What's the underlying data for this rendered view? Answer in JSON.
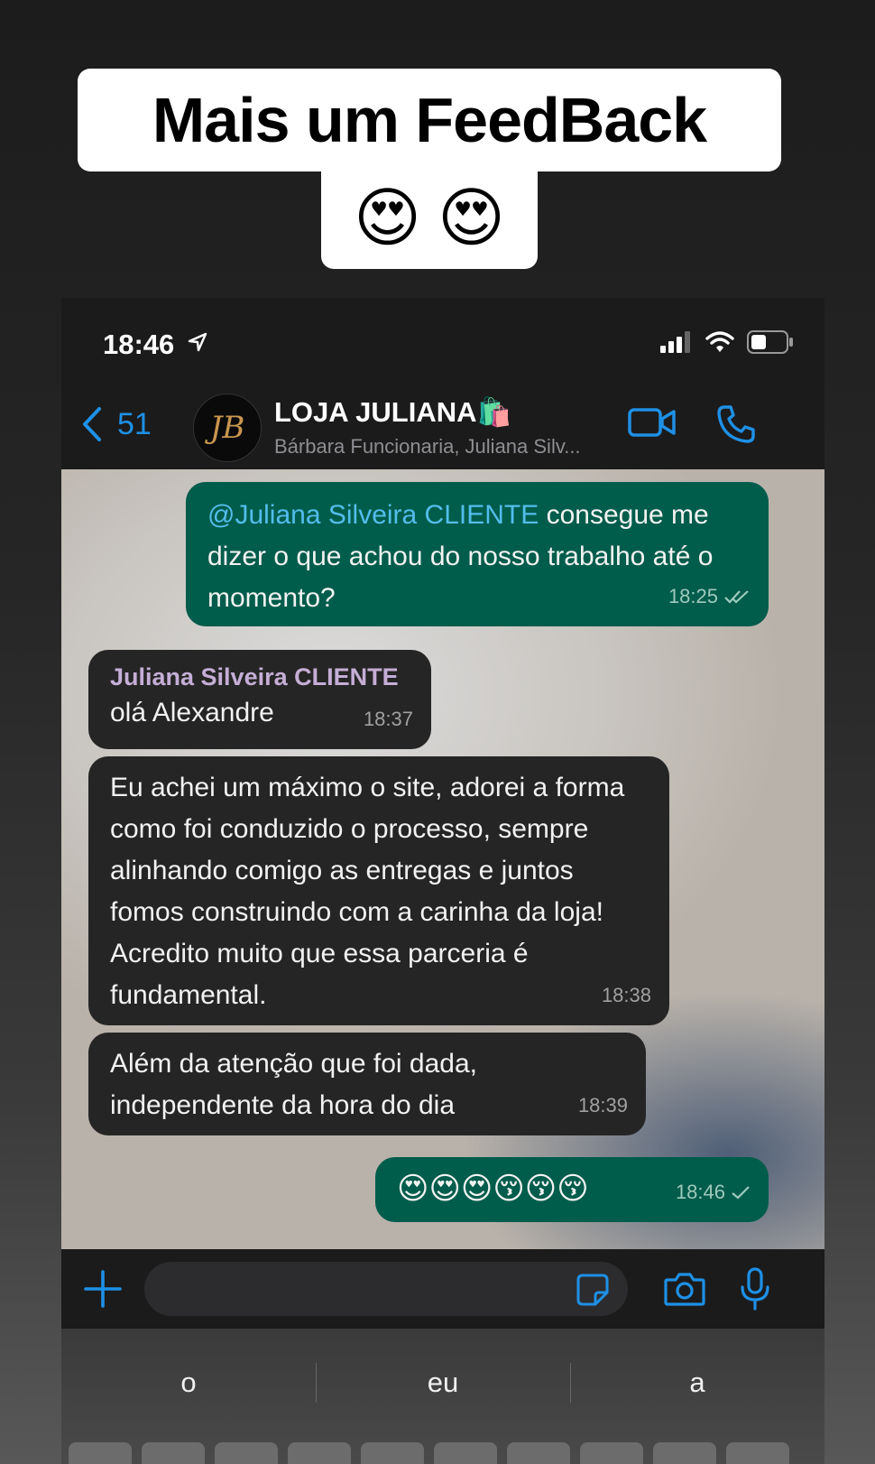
{
  "overlay": {
    "caption_line1": "Mais um FeedBack",
    "caption_emojis": [
      "😍",
      "😍"
    ]
  },
  "status_bar": {
    "time": "18:46"
  },
  "header": {
    "back_count": "51",
    "avatar_monogram": "JB",
    "group_name": "LOJA JULIANA🛍️",
    "members": "Bárbara Funcionaria, Juliana Silv..."
  },
  "messages": [
    {
      "direction": "outgoing",
      "mention": "@Juliana Silveira CLIENTE",
      "text": " consegue me dizer o que achou do nosso trabalho até o momento?",
      "time": "18:25",
      "status": "read"
    },
    {
      "direction": "incoming",
      "sender": "Juliana Silveira CLIENTE",
      "text": "olá Alexandre",
      "time": "18:37"
    },
    {
      "direction": "incoming",
      "text": "Eu achei um máximo o site, adorei a forma como foi conduzido o processo, sempre alinhando comigo as entregas e juntos fomos construindo com a carinha da loja! Acredito muito que essa parceria é fundamental.",
      "time": "18:38"
    },
    {
      "direction": "incoming",
      "text": "Além da atenção que foi dada, independente da hora do dia",
      "time": "18:39"
    },
    {
      "direction": "outgoing",
      "text": "😍😍😍😚😚😚",
      "time": "18:46",
      "status": "sent"
    }
  ],
  "input": {
    "placeholder": ""
  },
  "keyboard": {
    "suggestions": [
      "o",
      "eu",
      "a"
    ]
  },
  "colors": {
    "accent": "#1e90e6",
    "outgoing_bubble": "#005c4b",
    "incoming_bubble": "#252525",
    "mention": "#53bdeb"
  }
}
